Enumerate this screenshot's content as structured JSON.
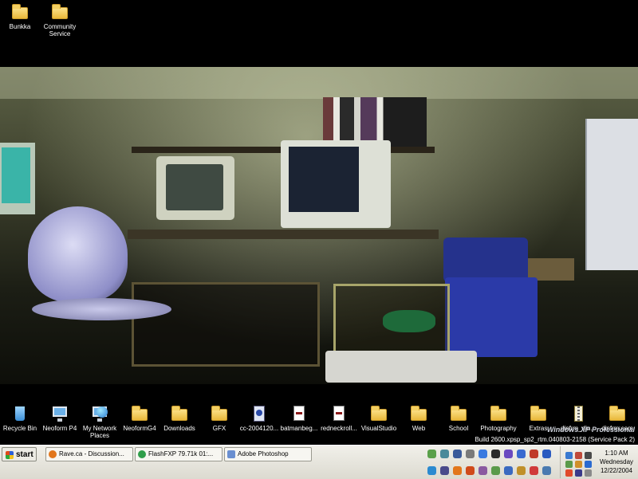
{
  "desktop": {
    "top_icons": [
      {
        "label": "Bunkka",
        "icon": "folder-icon"
      },
      {
        "label": "Community Service",
        "icon": "folder-icon"
      }
    ],
    "bottom_icons": [
      {
        "label": "Recycle Bin",
        "icon": "recycle-bin-icon"
      },
      {
        "label": "Neoform P4",
        "icon": "computer-icon"
      },
      {
        "label": "My Network Places",
        "icon": "network-places-icon"
      },
      {
        "label": "NeoformG4",
        "icon": "network-folder-icon"
      },
      {
        "label": "Downloads",
        "icon": "folder-icon"
      },
      {
        "label": "GFX",
        "icon": "folder-icon"
      },
      {
        "label": "cc-2004120...",
        "icon": "video-file-icon"
      },
      {
        "label": "batmanbeg...",
        "icon": "document-icon"
      },
      {
        "label": "redneckroll...",
        "icon": "document-icon"
      },
      {
        "label": "VisualStudio",
        "icon": "folder-icon"
      },
      {
        "label": "Web",
        "icon": "folder-icon"
      },
      {
        "label": "School",
        "icon": "folder-icon"
      },
      {
        "label": "Photography",
        "icon": "folder-icon"
      },
      {
        "label": "Extras",
        "icon": "folder-icon"
      },
      {
        "label": "dinfrm_din...",
        "icon": "zip-file-icon"
      },
      {
        "label": "dinfrm.com",
        "icon": "folder-icon"
      }
    ],
    "watermark": {
      "line1": "Windows XP Professional",
      "line2": "Build 2600.xpsp_sp2_rtm.040803-2158 (Service Pack 2)"
    }
  },
  "taskbar": {
    "start_label": "start",
    "tasks": [
      {
        "label": "Rave.ca - Discussion...",
        "icon": "firefox-icon",
        "color": "#e2761b"
      },
      {
        "label": "FlashFXP 79.71k 01:...",
        "icon": "flashfxp-icon",
        "color": "#2f9e4a"
      },
      {
        "label": "Adobe Photoshop",
        "icon": "photoshop-icon",
        "color": "#6a8fd0"
      }
    ],
    "clock": {
      "time": "1:10 AM",
      "day": "Wednesday",
      "date": "12/22/2004"
    }
  },
  "colors": {
    "desktop_bg": "#000000",
    "taskbar_bg": "#ecebe4",
    "folder": "#f3cf62"
  }
}
